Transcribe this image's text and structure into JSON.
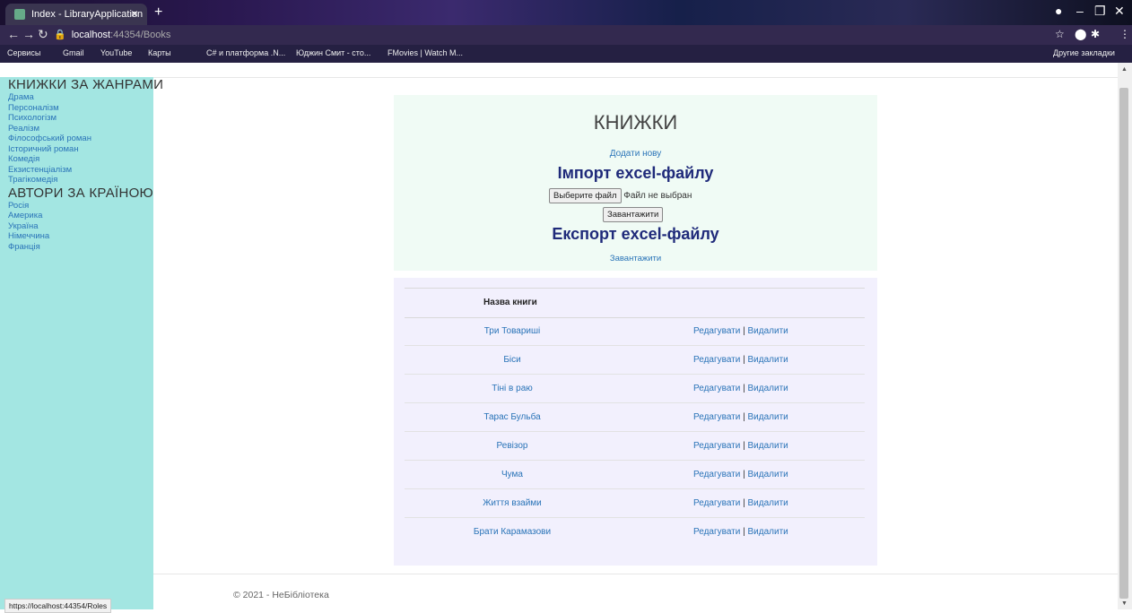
{
  "browser": {
    "tab_title": "Index - LibraryApplication",
    "tab_close": "×",
    "new_tab": "+",
    "url_host": "localhost",
    "url_path": ":44354/Books",
    "bookmarks": [
      "Сервисы",
      "Gmail",
      "YouTube",
      "Карты",
      "C# и платформа .N...",
      "Юджин Смит - сто...",
      "FMovies | Watch M...",
      "Другие закладки"
    ]
  },
  "sidebar": {
    "genres_heading": "КНИЖКИ ЗА ЖАНРАМИ",
    "genres": [
      "Драма",
      "Персоналізм",
      "Психологізм",
      "Реалізм",
      "Філософський роман",
      "Історичний роман",
      "Комедія",
      "Екзистенціалізм",
      "Трагікомедія"
    ],
    "countries_heading": "АВТОРИ ЗА КРАЇНОЮ",
    "countries": [
      "Росія",
      "Америка",
      "Україна",
      "Німеччина",
      "Франція"
    ]
  },
  "main": {
    "title": "КНИЖКИ",
    "add_new": "Додати нову",
    "import_heading": "Імпорт excel-файлу",
    "choose_file_button": "Выберите файл",
    "no_file_text": "Файл не выбран",
    "upload_button": "Завантажити",
    "export_heading": "Експорт excel-файлу",
    "export_link": "Завантажити"
  },
  "table": {
    "header": "Назва книги",
    "edit_label": "Редагувати",
    "separator": "|",
    "delete_label": "Видалити",
    "rows": [
      "Три Товариші",
      "Біси",
      "Тіні в раю",
      "Тарас Бульба",
      "Ревізор",
      "Чума",
      "Життя взайми",
      "Брати Карамазови"
    ]
  },
  "footer": {
    "text": "© 2021 - НеБібліотека"
  },
  "status_bar": {
    "url": "https://localhost:44354/Roles"
  }
}
